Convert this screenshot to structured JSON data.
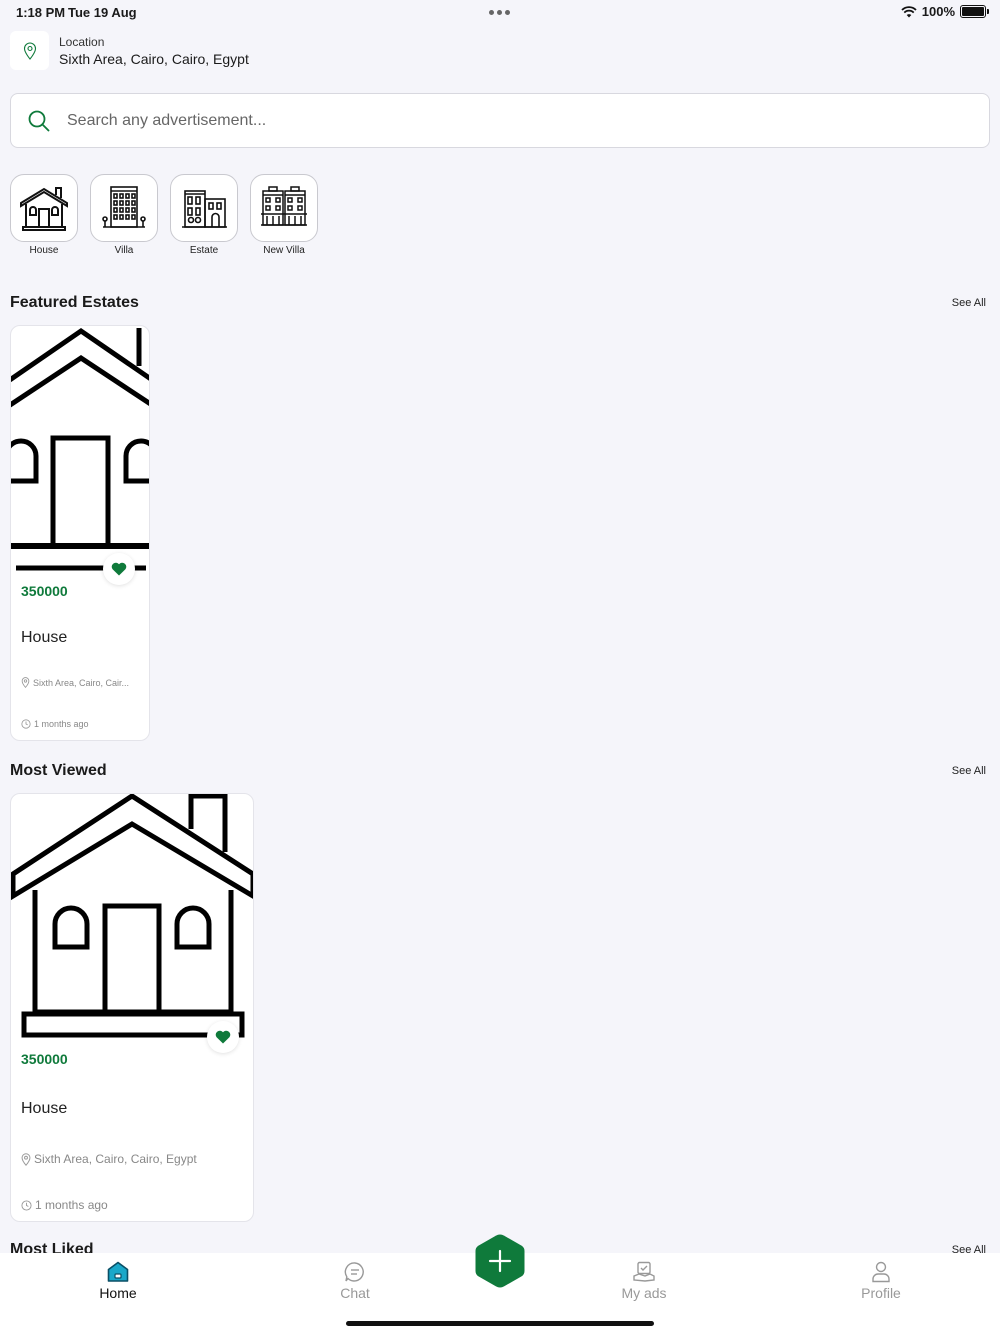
{
  "status_bar": {
    "time": "1:18 PM",
    "date": "Tue 19 Aug",
    "battery": "100%"
  },
  "location": {
    "label": "Location",
    "value": "Sixth Area, Cairo, Cairo, Egypt"
  },
  "search": {
    "placeholder": "Search any advertisement..."
  },
  "categories": [
    {
      "label": "House",
      "icon": "house-icon"
    },
    {
      "label": "Villa",
      "icon": "villa-icon"
    },
    {
      "label": "Estate",
      "icon": "estate-icon"
    },
    {
      "label": "New Villa",
      "icon": "new-villa-icon"
    }
  ],
  "featured": {
    "title": "Featured Estates",
    "see_all": "See All",
    "cards": [
      {
        "price": "350000",
        "title": "House",
        "location": "Sixth Area, Cairo, Cair...",
        "time": "1 months ago"
      }
    ]
  },
  "most_viewed": {
    "title": "Most Viewed",
    "see_all": "See All",
    "cards": [
      {
        "price": "350000",
        "title": "House",
        "location": "Sixth Area, Cairo, Cairo, Egypt",
        "time": "1 months ago"
      }
    ]
  },
  "most_liked": {
    "title": "Most Liked",
    "see_all": "See All"
  },
  "bottom_nav": {
    "items": [
      {
        "label": "Home",
        "icon": "home-icon",
        "active": true
      },
      {
        "label": "Chat",
        "icon": "chat-icon",
        "active": false
      },
      {
        "label": "My ads",
        "icon": "my-ads-icon",
        "active": false
      },
      {
        "label": "Profile",
        "icon": "profile-icon",
        "active": false
      }
    ],
    "fab_icon": "plus-icon"
  },
  "colors": {
    "accent": "#0f7a3b",
    "background": "#f5f5fa",
    "nav_active": "#1aa8c9"
  }
}
